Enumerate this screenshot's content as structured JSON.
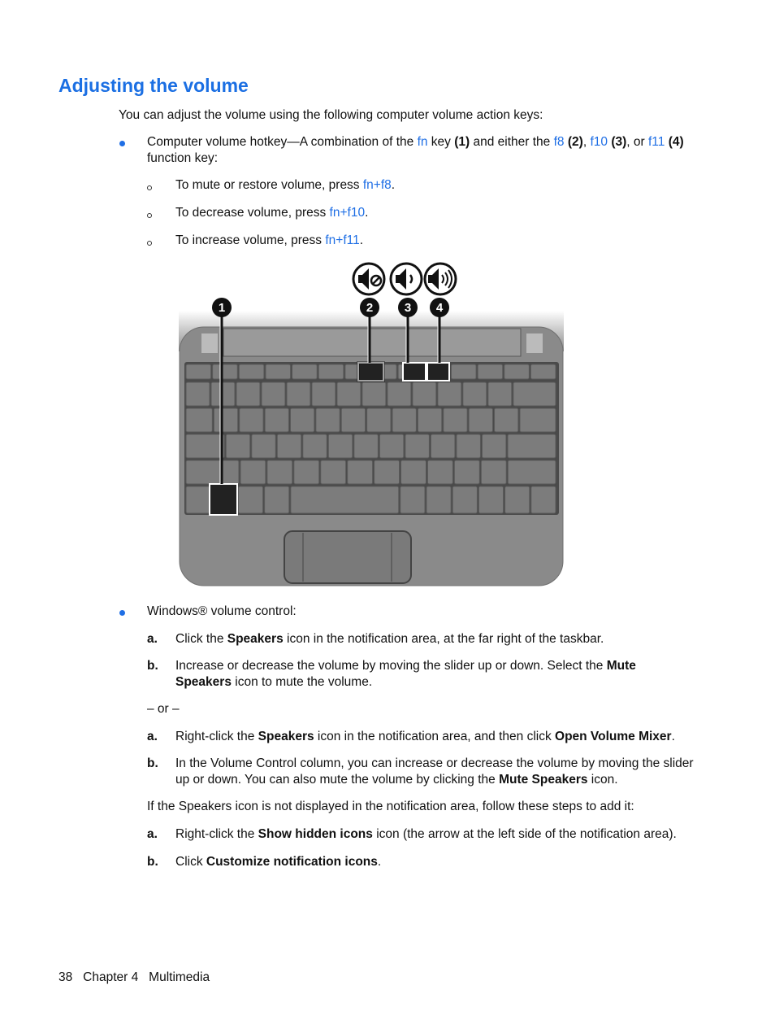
{
  "title": "Adjusting the volume",
  "intro": "You can adjust the volume using the following computer volume action keys:",
  "hotkey": {
    "t1": "Computer volume hotkey—A combination of the ",
    "fn": "fn",
    "t2": " key ",
    "n1": "(1)",
    "t3": " and either the ",
    "f8": "f8",
    "n2": "(2)",
    "t4": ", ",
    "f10": "f10",
    "n3": "(3)",
    "t5": ", or ",
    "f11": "f11",
    "n4": "(4)",
    "line2": "function key:",
    "sub": [
      {
        "text": "To mute or restore volume, press ",
        "key": "fn+f8",
        "end": "."
      },
      {
        "text": "To decrease volume, press ",
        "key": "fn+f10",
        "end": "."
      },
      {
        "text": "To increase volume, press ",
        "key": "fn+f11",
        "end": "."
      }
    ]
  },
  "figure": {
    "callouts": [
      "1",
      "2",
      "3",
      "4"
    ],
    "icons": [
      "speaker-mute-icon",
      "speaker-down-icon",
      "speaker-up-icon"
    ]
  },
  "windows": {
    "heading": "Windows® volume control:",
    "steps1": [
      {
        "label": "a.",
        "t1": "Click the ",
        "b1": "Speakers",
        "t2": " icon in the notification area, at the far right of the taskbar."
      },
      {
        "label": "b.",
        "t1": "Increase or decrease the volume by moving the slider up or down. Select the ",
        "b1": "Mute",
        "b2": "Speakers",
        "t2": " icon to mute the volume."
      }
    ],
    "or": "– or –",
    "steps2": [
      {
        "label": "a.",
        "t1": "Right-click the ",
        "b1": "Speakers",
        "t2": " icon in the notification area, and then click ",
        "b2": "Open Volume Mixer",
        "t3": "."
      },
      {
        "label": "b.",
        "t1": "In the Volume Control column, you can increase or decrease the volume by moving the slider",
        "t2": "up or down. You can also mute the volume by clicking the ",
        "b1": "Mute Speakers",
        "t3": " icon."
      }
    ],
    "note": "If the Speakers icon is not displayed in the notification area, follow these steps to add it:",
    "steps3": [
      {
        "label": "a.",
        "t1": "Right-click the ",
        "b1": "Show hidden icons",
        "t2": " icon (the arrow at the left side of the notification area)."
      },
      {
        "label": "b.",
        "t1": "Click ",
        "b1": "Customize notification icons",
        "t2": "."
      }
    ]
  },
  "footer": {
    "page": "38",
    "chapter": "Chapter 4",
    "section": "Multimedia"
  },
  "colors": {
    "heading": "#1b6fe3",
    "link": "#1f6fe5"
  }
}
